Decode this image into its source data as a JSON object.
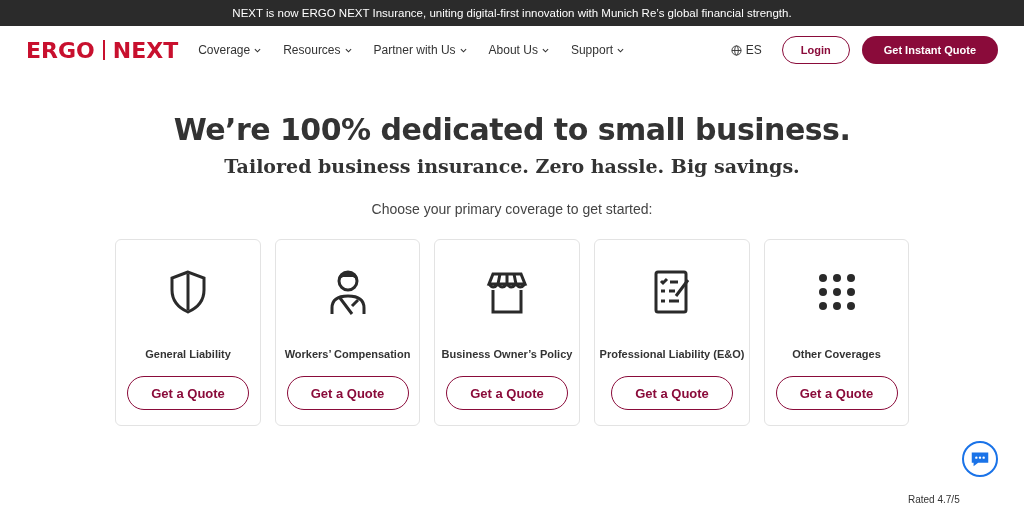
{
  "announcement": "NEXT is now ERGO NEXT Insurance, uniting digital-first innovation with Munich Re’s global financial strength.",
  "logo": {
    "left": "ERGO",
    "right": "NEXT"
  },
  "nav": [
    {
      "label": "Coverage"
    },
    {
      "label": "Resources"
    },
    {
      "label": "Partner with Us"
    },
    {
      "label": "About Us"
    },
    {
      "label": "Support"
    }
  ],
  "language": "ES",
  "login": "Login",
  "cta": "Get Instant Quote",
  "hero": {
    "title": "We’re 100% dedicated to small business.",
    "subtitle": "Tailored business insurance. Zero hassle. Big savings.",
    "prompt": "Choose your primary coverage to get started:"
  },
  "coverages": [
    {
      "kind": "shield",
      "label": "General Liability",
      "button": "Get a Quote"
    },
    {
      "kind": "worker",
      "label": "Workers’ Compensation",
      "button": "Get a Quote"
    },
    {
      "kind": "store",
      "label": "Business Owner’s Policy",
      "button": "Get a Quote"
    },
    {
      "kind": "checklist",
      "label": "Professional Liability (E&O)",
      "button": "Get a Quote"
    },
    {
      "kind": "dots",
      "label": "Other Coverages",
      "button": "Get a Quote"
    }
  ],
  "rating": "Rated 4.7/5"
}
